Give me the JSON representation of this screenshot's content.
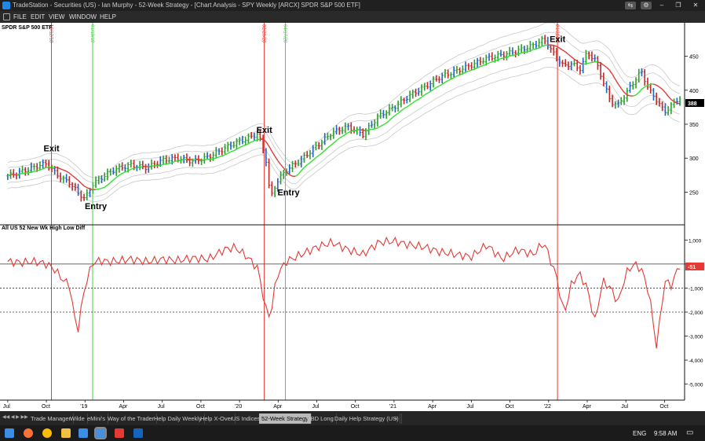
{
  "window": {
    "title": "TradeStation - Securities (US) - Ian Murphy - 52-Week Strategy - [Chart Analysis - SPY Weekly [ARCX] SPDR S&P 500 ETF]",
    "controls": [
      "⇆",
      "⚙",
      "–",
      "❐",
      "✕"
    ]
  },
  "menu": {
    "items": [
      "FILE",
      "EDIT",
      "VIEW",
      "WINDOW",
      "HELP"
    ]
  },
  "price_panel": {
    "symbol_label": "SPDR S&P 500 ETF",
    "axis_ticks": [
      "450",
      "400",
      "350",
      "300",
      "250"
    ],
    "last_price": "388"
  },
  "indicator_panel": {
    "label": "All US 52 New Wk High Low Diff",
    "axis_ticks": [
      "1,000",
      "0",
      "-1,000",
      "-2,000",
      "-3,000",
      "-4,000",
      "-5,000"
    ],
    "last_value": "-51"
  },
  "time_axis": [
    "Jul",
    "Oct",
    "'19",
    "Apr",
    "Jul",
    "Oct",
    "'20",
    "Apr",
    "Jul",
    "Oct",
    "'21",
    "Apr",
    "Jul",
    "Oct",
    "'22",
    "Apr",
    "Jul",
    "Oct"
  ],
  "signals": [
    {
      "type": "Exit",
      "date": "10/12/18",
      "color": "#e53935"
    },
    {
      "type": "Entry",
      "date": "01/18/19",
      "color": "#43d843"
    },
    {
      "type": "Exit",
      "date": "02/28/20",
      "color": "#e53935"
    },
    {
      "type": "Entry",
      "date": "04/17/20",
      "color": "#43d843"
    },
    {
      "type": "Exit",
      "date": "01/21/22",
      "color": "#e53935"
    }
  ],
  "colors": {
    "up_bar": "#2e9e2e",
    "down_bar": "#c62828",
    "neutral_bar": "#1e63c8",
    "ma_up": "#32e032",
    "ma_down": "#e53935",
    "indicator": "#e53935"
  },
  "chart_data": {
    "type": "bar",
    "symbol": "SPY Weekly",
    "ylim": [
      210,
      490
    ],
    "indicator_ylim": [
      -5600,
      1600
    ],
    "x": [
      2018.5,
      2018.55,
      2018.6,
      2018.65,
      2018.7,
      2018.75,
      2018.8,
      2018.85,
      2018.9,
      2018.95,
      2019.0,
      2019.05,
      2019.1,
      2019.15,
      2019.2,
      2019.3,
      2019.4,
      2019.5,
      2019.6,
      2019.7,
      2019.8,
      2019.9,
      2019.97,
      2020.05,
      2020.12,
      2020.17,
      2020.2,
      2020.24,
      2020.3,
      2020.4,
      2020.5,
      2020.6,
      2020.7,
      2020.8,
      2020.9,
      2021.0,
      2021.1,
      2021.2,
      2021.3,
      2021.4,
      2021.5,
      2021.6,
      2021.7,
      2021.8,
      2021.9,
      2021.97,
      2022.05,
      2022.1,
      2022.15,
      2022.2,
      2022.25,
      2022.3,
      2022.35,
      2022.4,
      2022.45,
      2022.5,
      2022.55,
      2022.6,
      2022.65,
      2022.7,
      2022.75,
      2022.8,
      2022.84
    ],
    "price": [
      274,
      277,
      281,
      285,
      289,
      292,
      280,
      270,
      264,
      250,
      240,
      262,
      270,
      278,
      284,
      290,
      286,
      297,
      300,
      295,
      302,
      314,
      322,
      329,
      336,
      300,
      240,
      265,
      282,
      298,
      318,
      338,
      346,
      335,
      362,
      375,
      392,
      405,
      420,
      428,
      437,
      447,
      452,
      458,
      466,
      475,
      448,
      435,
      440,
      430,
      455,
      445,
      415,
      383,
      378,
      395,
      412,
      428,
      400,
      385,
      368,
      378,
      388
    ],
    "indicator": [
      100,
      80,
      60,
      100,
      80,
      0,
      -200,
      -600,
      -900,
      -2900,
      -900,
      50,
      150,
      100,
      120,
      200,
      100,
      200,
      150,
      250,
      200,
      600,
      700,
      300,
      -200,
      -1900,
      -2200,
      -500,
      100,
      400,
      700,
      900,
      600,
      400,
      900,
      950,
      800,
      700,
      500,
      400,
      300,
      800,
      200,
      600,
      400,
      900,
      -500,
      -2100,
      -800,
      -400,
      -1000,
      -2400,
      -700,
      -1000,
      -1600,
      -400,
      0,
      -200,
      -1200,
      -3500,
      -700,
      -900,
      -51
    ]
  }
}
